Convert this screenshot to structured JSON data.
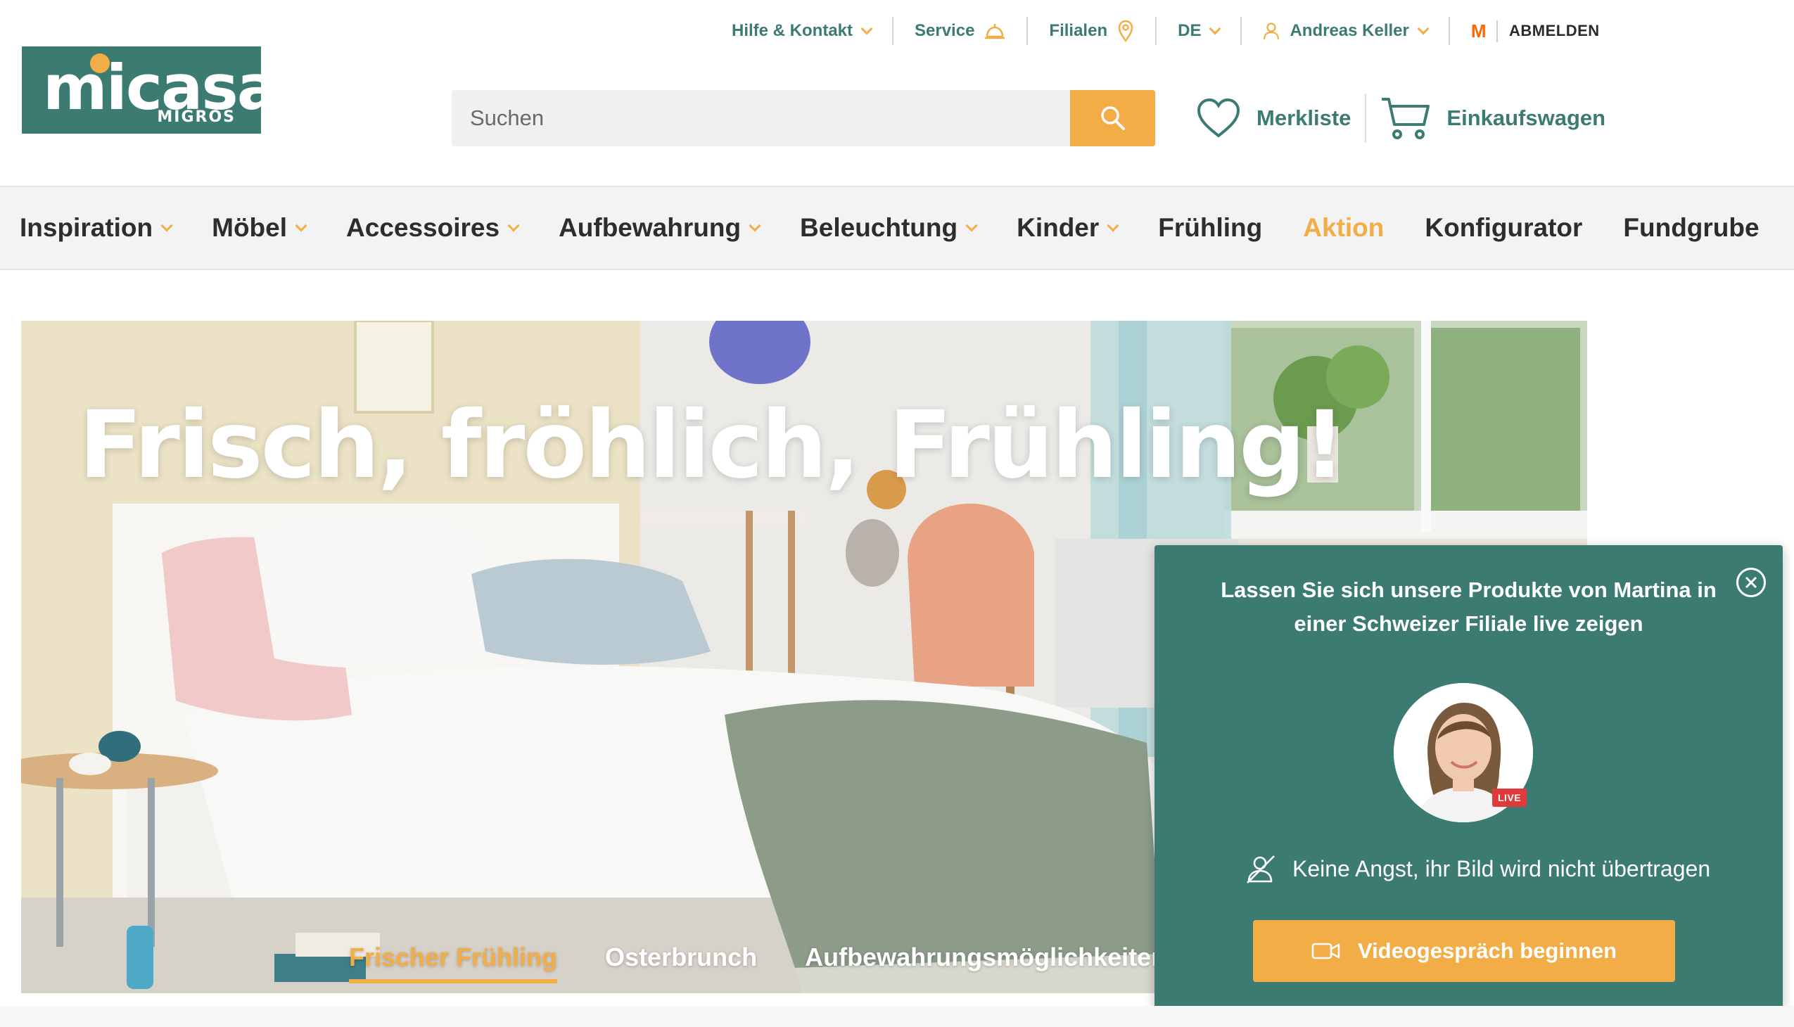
{
  "logo": {
    "name": "micasa",
    "sub": "MIGROS"
  },
  "topbar": {
    "help": "Hilfe & Kontakt",
    "service": "Service",
    "stores": "Filialen",
    "language": "DE",
    "user": "Andreas Keller",
    "migros_mark": "M",
    "logout": "ABMELDEN"
  },
  "search": {
    "placeholder": "Suchen"
  },
  "quicklinks": {
    "wishlist": "Merkliste",
    "cart": "Einkaufswagen"
  },
  "nav": {
    "items": [
      {
        "label": "Inspiration"
      },
      {
        "label": "Möbel"
      },
      {
        "label": "Accessoires"
      },
      {
        "label": "Aufbewahrung"
      },
      {
        "label": "Beleuchtung"
      },
      {
        "label": "Kinder"
      },
      {
        "label": "Frühling"
      },
      {
        "label": "Aktion"
      },
      {
        "label": "Konfigurator"
      },
      {
        "label": "Fundgrube"
      }
    ]
  },
  "hero": {
    "title": "Frisch, fröhlich, Frühling!",
    "tabs": [
      {
        "label": "Frischer Frühling"
      },
      {
        "label": "Osterbrunch"
      },
      {
        "label": "Aufbewahrungsmöglichkeiten für de"
      }
    ]
  },
  "popup": {
    "title": "Lassen Sie sich unsere Produkte von Martina in einer Schweizer Filiale live zeigen",
    "live_badge": "LIVE",
    "note": "Keine Angst, ihr Bild wird nicht übertragen",
    "button": "Videogespräch beginnen"
  },
  "colors": {
    "brand": "#3b7b72",
    "accent": "#f2ad46",
    "live": "#e03a3a"
  }
}
